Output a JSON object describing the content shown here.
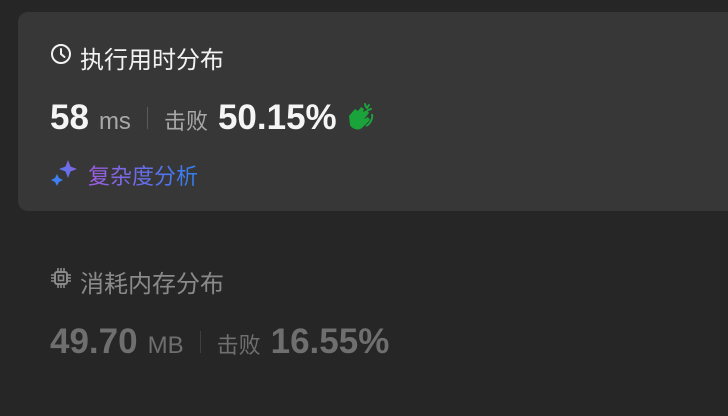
{
  "runtime": {
    "title": "执行用时分布",
    "value": "58",
    "unit": "ms",
    "beat_label": "击败",
    "beat_percent": "50.15%",
    "analysis_link": "复杂度分析"
  },
  "memory": {
    "title": "消耗内存分布",
    "value": "49.70",
    "unit": "MB",
    "beat_label": "击败",
    "beat_percent": "16.55%"
  },
  "colors": {
    "clap": "#1aa33a",
    "card": "#373737",
    "background": "#262626"
  }
}
